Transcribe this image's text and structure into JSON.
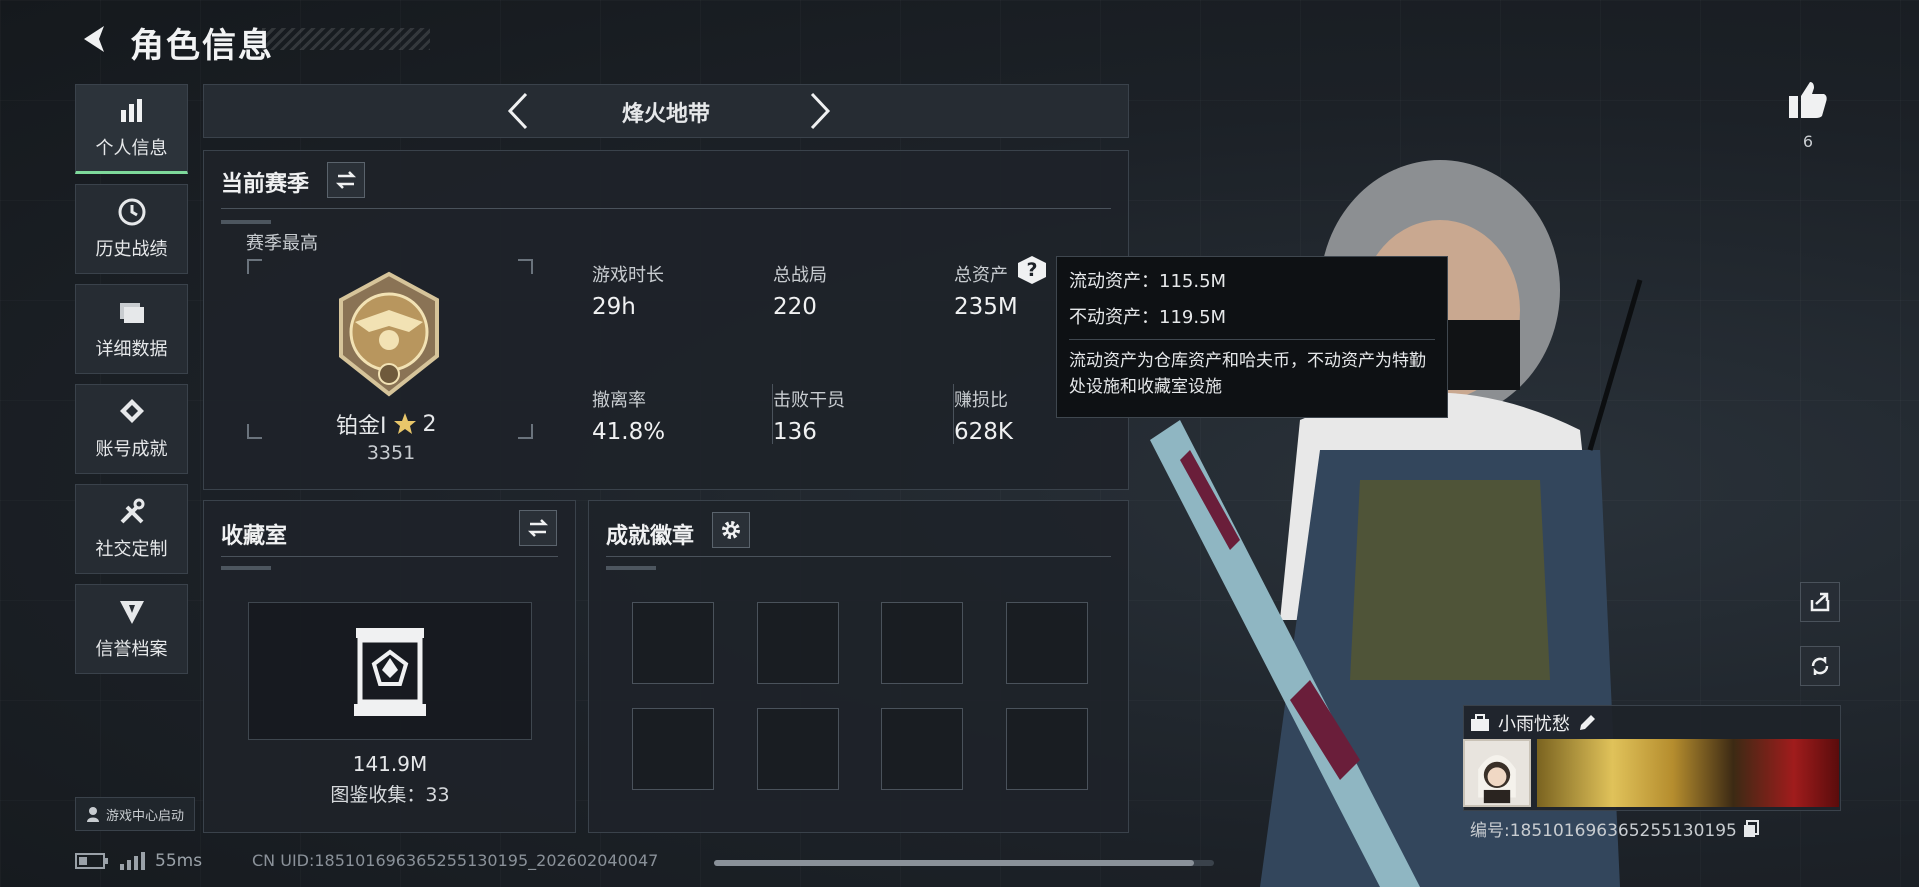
{
  "header": {
    "title": "角色信息"
  },
  "sidebar": {
    "items": [
      {
        "label": "个人信息",
        "icon": "bar-chart-icon",
        "active": true
      },
      {
        "label": "历史战绩",
        "icon": "clock-icon"
      },
      {
        "label": "详细数据",
        "icon": "folder-icon"
      },
      {
        "label": "账号成就",
        "icon": "achievement-icon"
      },
      {
        "label": "社交定制",
        "icon": "tools-icon"
      },
      {
        "label": "信誉档案",
        "icon": "reputation-icon"
      }
    ],
    "launch_label": "游戏中心启动"
  },
  "mode": {
    "title": "烽火地带"
  },
  "season": {
    "title": "当前赛季",
    "best_label": "赛季最高",
    "rank": "铂金I",
    "stars": "2",
    "score": "3351",
    "stats": [
      {
        "label": "游戏时长",
        "value": "29h"
      },
      {
        "label": "总战局",
        "value": "220"
      },
      {
        "label": "总资产",
        "value": "235M"
      },
      {
        "label": "撤离率",
        "value": "41.8%"
      },
      {
        "label": "击败干员",
        "value": "136"
      },
      {
        "label": "赚损比",
        "value": "628K"
      }
    ]
  },
  "tooltip": {
    "liquid": "流动资产：115.5M",
    "fixed": "不动资产：119.5M",
    "desc": "流动资产为仓库资产和哈夫币，不动资产为特勤处设施和收藏室设施"
  },
  "collection": {
    "title": "收藏室",
    "value": "141.9M",
    "count_label": "图鉴收集：33"
  },
  "badges": {
    "title": "成就徽章"
  },
  "player": {
    "name": "小雨忧愁",
    "id_label": "编号:18510169636525513019​5",
    "likes": "6"
  },
  "status": {
    "ping": "55ms",
    "uid": "CN UID:18510169636525513019​5_202602040047"
  },
  "colors": {
    "accent": "#7ed99b",
    "panel": "#262c33",
    "tooltip_bg": "#0e1114"
  }
}
